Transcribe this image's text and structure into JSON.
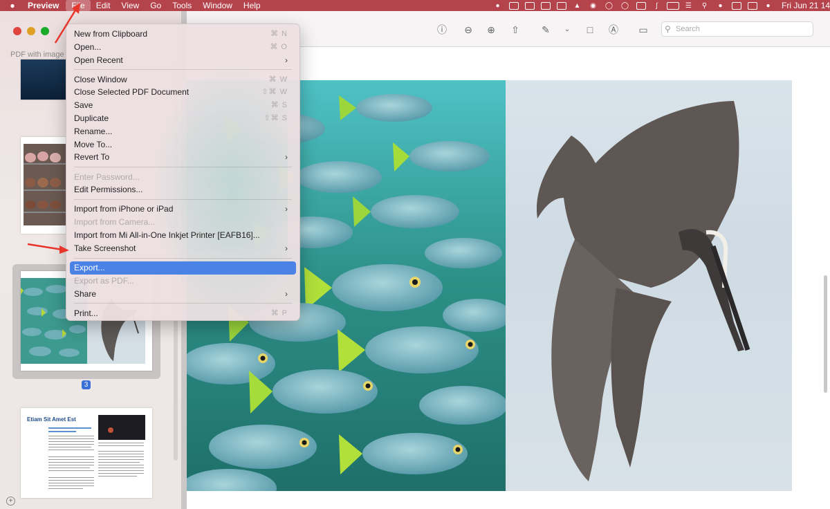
{
  "menubar": {
    "app_name": "Preview",
    "menus": [
      "File",
      "Edit",
      "View",
      "Go",
      "Tools",
      "Window",
      "Help"
    ],
    "date": "Fri Jun 21  14:"
  },
  "sidebar": {
    "doc_title": "PDF with image",
    "selected_page": "3",
    "thumb4_heading": "Etiam Sit Amet Est"
  },
  "toolbar": {
    "search_placeholder": "Search"
  },
  "file_menu": {
    "items": [
      {
        "label": "New from Clipboard",
        "shortcut": "⌘ N"
      },
      {
        "label": "Open...",
        "shortcut": "⌘ O"
      },
      {
        "label": "Open Recent",
        "submenu": true
      },
      {
        "sep": true
      },
      {
        "label": "Close Window",
        "shortcut": "⌘ W"
      },
      {
        "label": "Close Selected PDF Document",
        "shortcut": "⇧⌘ W"
      },
      {
        "label": "Save",
        "shortcut": "⌘ S"
      },
      {
        "label": "Duplicate",
        "shortcut": "⇧⌘ S"
      },
      {
        "label": "Rename..."
      },
      {
        "label": "Move To..."
      },
      {
        "label": "Revert To",
        "submenu": true
      },
      {
        "sep": true
      },
      {
        "label": "Enter Password...",
        "disabled": true
      },
      {
        "label": "Edit Permissions..."
      },
      {
        "sep": true
      },
      {
        "label": "Import from iPhone or iPad",
        "submenu": true
      },
      {
        "label": "Import from Camera...",
        "disabled": true
      },
      {
        "label": "Import from Mi All-in-One Inkjet Printer [EAFB16]..."
      },
      {
        "label": "Take Screenshot",
        "submenu": true
      },
      {
        "sep": true
      },
      {
        "label": "Export...",
        "highlight": true
      },
      {
        "label": "Export as PDF...",
        "disabled": true
      },
      {
        "label": "Share",
        "submenu": true
      },
      {
        "sep": true
      },
      {
        "label": "Print...",
        "shortcut": "⌘ P"
      }
    ]
  },
  "colors": {
    "menubar_bg": "#b5434c",
    "highlight": "#4b82e6",
    "annotation_arrow": "#e8352b"
  }
}
